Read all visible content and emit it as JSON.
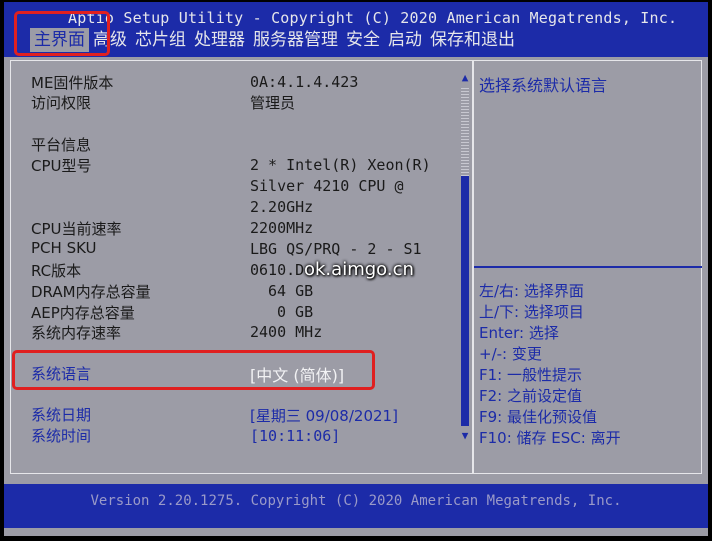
{
  "header": {
    "title": "Aptio Setup Utility - Copyright (C) 2020 American Megatrends, Inc."
  },
  "menu": {
    "items": [
      "主界面",
      "高级",
      "芯片组",
      "处理器",
      "服务器管理",
      "安全",
      "启动",
      "保存和退出"
    ]
  },
  "info": {
    "me_label": "ME固件版本",
    "me_value": "0A:4.1.4.423",
    "access_label": "访问权限",
    "access_value": "管理员",
    "platform_heading": "平台信息",
    "cpu_label": "CPU型号",
    "cpu_value_1": "2 * Intel(R) Xeon(R)",
    "cpu_value_2": "Silver 4210 CPU @",
    "cpu_value_3": "2.20GHz",
    "cpu_speed_label": "CPU当前速率",
    "cpu_speed_value": "2200MHz",
    "pch_label": "PCH SKU",
    "pch_value": "LBG QS/PRQ - 2 - S1",
    "rc_label": "RC版本",
    "rc_value": "0610.D",
    "dram_label": "DRAM内存总容量",
    "dram_value": "64 GB",
    "aep_label": "AEP内存总容量",
    "aep_value": "0 GB",
    "mem_speed_label": "系统内存速率",
    "mem_speed_value": "2400 MHz"
  },
  "settings": {
    "language_label": "系统语言",
    "language_value": "[中文 (简体)]",
    "date_label": "系统日期",
    "date_value": "[星期三 09/08/2021]",
    "time_label": "系统时间",
    "time_value": "[10:11:06]"
  },
  "help": {
    "description": "选择系统默认语言",
    "keys": [
      "左/右: 选择界面",
      "上/下: 选择项目",
      "Enter: 选择",
      "+/-: 变更",
      "F1: 一般性提示",
      "F2: 之前设定值",
      "F9: 最佳化预设值",
      "F10: 储存  ESC: 离开"
    ]
  },
  "footer": {
    "version": "Version 2.20.1275. Copyright (C) 2020 American Megatrends, Inc."
  },
  "watermark": "ok.aimgo.cn",
  "colors": {
    "header_blue": "#1c2ba8",
    "panel_gray": "#9c9ca6",
    "highlight_red": "#e02020"
  }
}
